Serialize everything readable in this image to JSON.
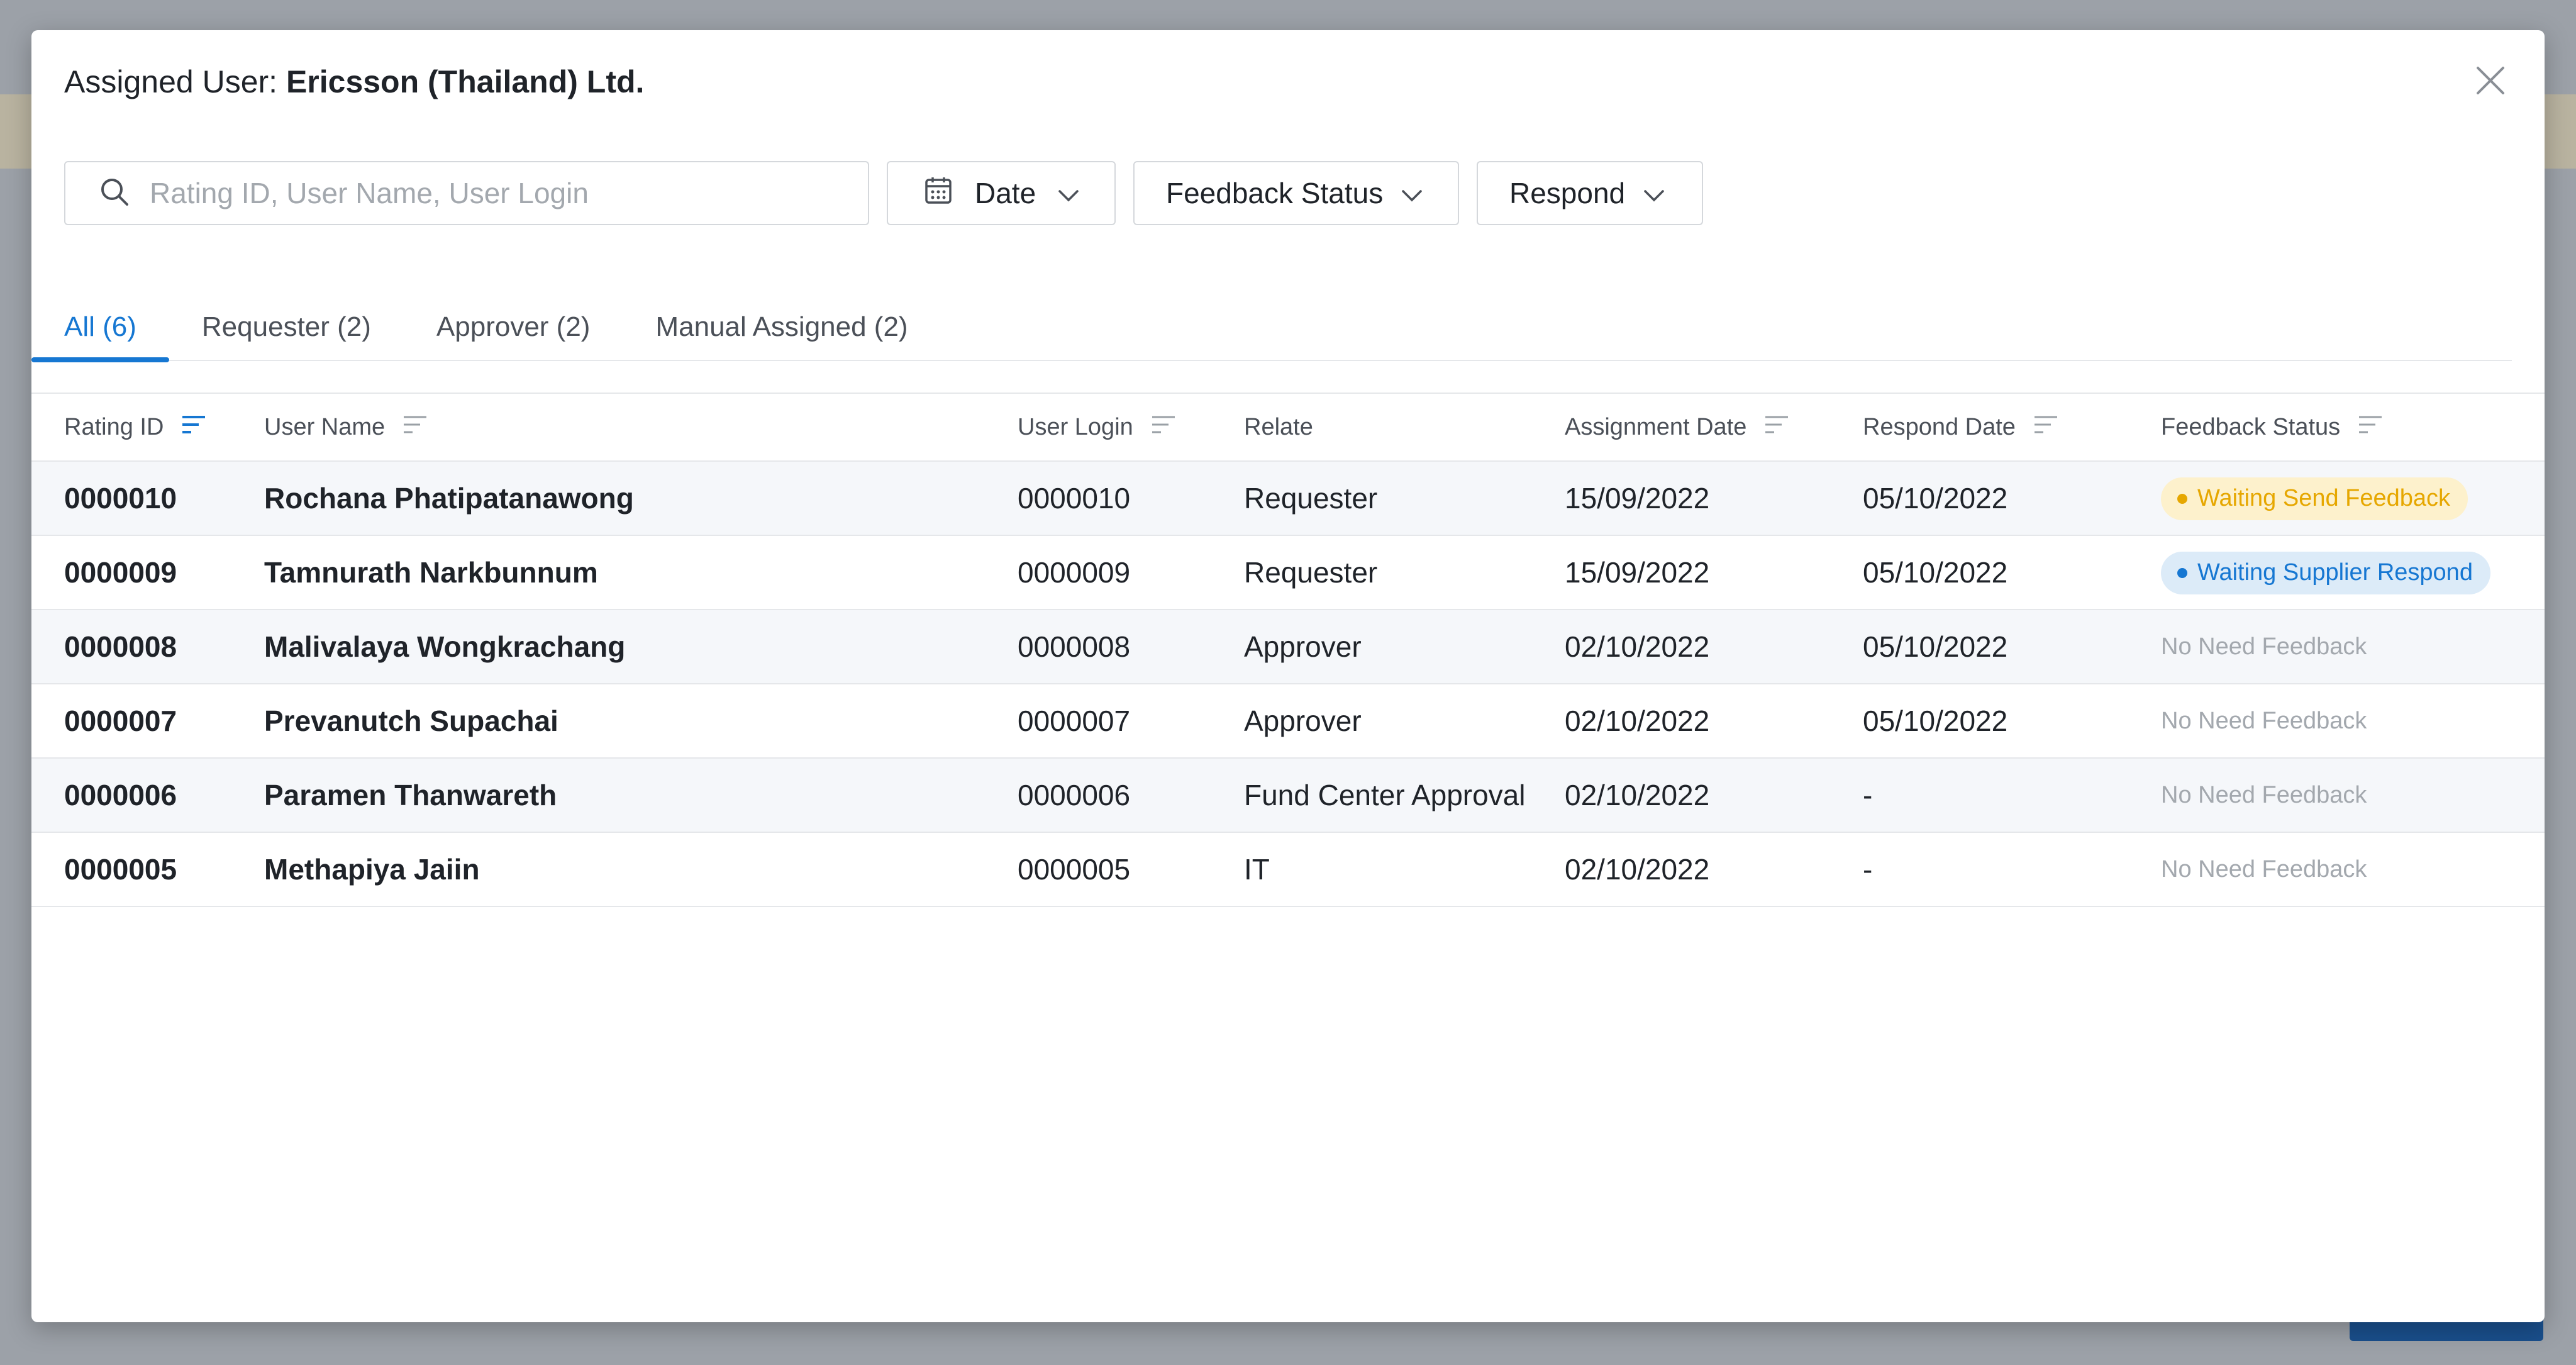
{
  "modal": {
    "title_prefix": "Assigned User: ",
    "title_company": "Ericsson (Thailand) Ltd."
  },
  "filters": {
    "search_placeholder": "Rating ID, User Name, User Login",
    "date_label": "Date",
    "feedback_status_label": "Feedback Status",
    "respond_label": "Respond"
  },
  "tabs": [
    {
      "label": "All (6)",
      "active": true
    },
    {
      "label": "Requester (2)",
      "active": false
    },
    {
      "label": "Approver (2)",
      "active": false
    },
    {
      "label": "Manual Assigned (2)",
      "active": false
    }
  ],
  "table": {
    "headers": {
      "rating_id": "Rating ID",
      "user_name": "User Name",
      "user_login": "User Login",
      "relate": "Relate",
      "assignment_date": "Assignment Date",
      "respond_date": "Respond Date",
      "feedback_status": "Feedback Status"
    },
    "rows": [
      {
        "rating_id": "0000010",
        "user_name": "Rochana Phatipatanawong",
        "user_login": "0000010",
        "relate": "Requester",
        "assignment_date": "15/09/2022",
        "respond_date": "05/10/2022",
        "feedback_status": "Waiting Send Feedback"
      },
      {
        "rating_id": "0000009",
        "user_name": "Tamnurath Narkbunnum",
        "user_login": "0000009",
        "relate": "Requester",
        "assignment_date": "15/09/2022",
        "respond_date": "05/10/2022",
        "feedback_status": "Waiting Supplier Respond"
      },
      {
        "rating_id": "0000008",
        "user_name": "Malivalaya Wongkrachang",
        "user_login": "0000008",
        "relate": "Approver",
        "assignment_date": "02/10/2022",
        "respond_date": "05/10/2022",
        "feedback_status": "No Need Feedback"
      },
      {
        "rating_id": "0000007",
        "user_name": "Prevanutch Supachai",
        "user_login": "0000007",
        "relate": "Approver",
        "assignment_date": "02/10/2022",
        "respond_date": "05/10/2022",
        "feedback_status": "No Need Feedback"
      },
      {
        "rating_id": "0000006",
        "user_name": "Paramen Thanwareth",
        "user_login": "0000006",
        "relate": "Fund Center Approval",
        "assignment_date": "02/10/2022",
        "respond_date": "-",
        "feedback_status": "No Need Feedback"
      },
      {
        "rating_id": "0000005",
        "user_name": "Methapiya Jaiin",
        "user_login": "0000005",
        "relate": "IT",
        "assignment_date": "02/10/2022",
        "respond_date": "-",
        "feedback_status": "No Need Feedback"
      }
    ]
  },
  "colors": {
    "accent": "#1677d2",
    "warning": "#e6a700",
    "warning_bg": "#fdf1cc",
    "info_bg": "#dcebf8",
    "muted": "#a3a8ae"
  }
}
